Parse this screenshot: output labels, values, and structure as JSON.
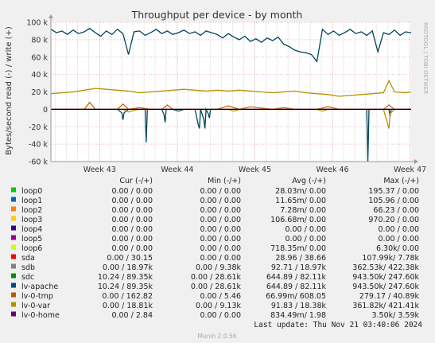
{
  "chart_data": {
    "type": "line",
    "title": "Throughput per device - by month",
    "ylabel": "Bytes/second read (-) / write (+)",
    "side_label": "RRDTOOL / TOBI OETIKER",
    "footer": "Munin 2.0.56",
    "last_update": "Last update: Thu Nov 21 03:40:06 2024",
    "ylim": [
      -60000,
      100000
    ],
    "yticks": [
      {
        "value": 100000,
        "label": "100 k"
      },
      {
        "value": 80000,
        "label": "80 k"
      },
      {
        "value": 60000,
        "label": "60 k"
      },
      {
        "value": 40000,
        "label": "40 k"
      },
      {
        "value": 20000,
        "label": "20 k"
      },
      {
        "value": 0,
        "label": "0"
      },
      {
        "value": -20000,
        "label": "-20 k"
      },
      {
        "value": -40000,
        "label": "-40 k"
      },
      {
        "value": -60000,
        "label": "-60 k"
      }
    ],
    "xlim": [
      0,
      32.5
    ],
    "xlim_note": "x in days since start of window",
    "xticks": [
      {
        "value": 4.4,
        "label": "Week 43"
      },
      {
        "value": 11.4,
        "label": "Week 44"
      },
      {
        "value": 18.4,
        "label": "Week 45"
      },
      {
        "value": 25.4,
        "label": "Week 46"
      },
      {
        "value": 32.4,
        "label": "Week 47"
      }
    ],
    "series": [
      {
        "name": "lv-apache write",
        "color": "#00455C",
        "x": [
          0,
          0.5,
          1,
          1.5,
          2,
          2.5,
          3,
          3.5,
          4,
          4.5,
          5,
          5.5,
          6,
          6.5,
          7,
          7.5,
          8,
          8.5,
          9,
          9.5,
          10,
          10.5,
          11,
          11.5,
          12,
          12.5,
          13,
          13.5,
          14,
          14.5,
          15,
          15.5,
          16,
          16.5,
          17,
          17.5,
          18,
          18.5,
          19,
          19.5,
          20,
          20.5,
          21,
          21.5,
          22,
          22.5,
          23,
          23.5,
          24,
          24.5,
          25,
          25.5,
          26,
          26.5,
          27,
          27.5,
          28,
          28.5,
          29,
          29.5,
          30,
          30.5,
          31,
          31.5,
          32,
          32.5
        ],
        "values": [
          92000,
          88000,
          90000,
          86000,
          91000,
          87000,
          89000,
          93000,
          88000,
          84000,
          90000,
          86000,
          92000,
          87000,
          63000,
          89000,
          90000,
          85000,
          88000,
          92000,
          87000,
          90000,
          86000,
          88000,
          91000,
          87000,
          89000,
          85000,
          90000,
          88000,
          86000,
          82000,
          87000,
          83000,
          80000,
          84000,
          78000,
          81000,
          77000,
          82000,
          79000,
          83000,
          75000,
          72000,
          68000,
          66000,
          65000,
          63000,
          55000,
          92000,
          86000,
          90000,
          85000,
          88000,
          92000,
          87000,
          89000,
          85000,
          90000,
          66000,
          88000,
          86000,
          91000,
          85000,
          89000,
          88000
        ]
      },
      {
        "name": "lv-apache read",
        "color": "#00455C",
        "x": [
          0,
          1,
          2,
          3,
          4,
          5,
          6,
          6.4,
          6.5,
          6.6,
          7,
          8,
          8.5,
          8.6,
          8.7,
          9,
          10,
          10.2,
          10.3,
          10.4,
          11,
          11.5,
          12,
          12.5,
          13,
          13.3,
          13.4,
          13.5,
          13.8,
          13.9,
          14,
          14.2,
          14.3,
          14.4,
          15,
          16,
          17,
          18,
          19,
          20,
          21,
          22,
          23,
          24,
          25,
          26,
          27,
          28,
          28.5,
          28.6,
          28.7,
          29,
          30,
          30.5,
          30.6,
          30.7,
          31,
          32,
          32.5
        ],
        "values": [
          0,
          0,
          0,
          0,
          0,
          0,
          0,
          -4000,
          -12000,
          -4000,
          0,
          0,
          0,
          -38000,
          0,
          0,
          0,
          -6000,
          -15000,
          0,
          0,
          -2000,
          0,
          0,
          0,
          -18000,
          -22000,
          0,
          -12000,
          -22000,
          0,
          -5000,
          -10000,
          0,
          0,
          0,
          0,
          0,
          0,
          0,
          0,
          0,
          0,
          0,
          0,
          0,
          0,
          0,
          0,
          -60000,
          0,
          0,
          0,
          0,
          -8000,
          0,
          0,
          0,
          0
        ]
      },
      {
        "name": "lv-0-var write",
        "color": "#B39400",
        "x": [
          0,
          1,
          2,
          3,
          4,
          5,
          6,
          7,
          8,
          9,
          10,
          11,
          12,
          13,
          14,
          15,
          16,
          17,
          18,
          19,
          20,
          21,
          22,
          23,
          24,
          25,
          26,
          27,
          28,
          29,
          30,
          30.5,
          31,
          32,
          32.5
        ],
        "values": [
          18000,
          19000,
          20000,
          22000,
          24000,
          23000,
          22000,
          21000,
          19000,
          20000,
          21000,
          22000,
          23000,
          22000,
          21000,
          22000,
          21000,
          22000,
          21000,
          20000,
          19000,
          20000,
          21000,
          19000,
          18000,
          17000,
          15000,
          16000,
          17000,
          18000,
          19000,
          33000,
          20000,
          19000,
          20000
        ]
      },
      {
        "name": "lv-0-var read",
        "color": "#B39400",
        "x": [
          0,
          6.5,
          7,
          7.5,
          8,
          16,
          16.5,
          17,
          24,
          24.5,
          25,
          30,
          30.5,
          30.6,
          31,
          32.5
        ],
        "values": [
          0,
          0,
          -3000,
          -1000,
          0,
          0,
          -2000,
          0,
          0,
          -2000,
          0,
          0,
          -22000,
          -5000,
          0,
          0
        ]
      },
      {
        "name": "lv-0-tmp write",
        "color": "#CC6600",
        "x": [
          0,
          3,
          3.5,
          4,
          6,
          6.5,
          7,
          8,
          9,
          10,
          10.5,
          11,
          15,
          16,
          17,
          18,
          20,
          21,
          22,
          24,
          25,
          26,
          28,
          30,
          30.5,
          31,
          32.5
        ],
        "values": [
          0,
          0,
          8000,
          0,
          0,
          6000,
          0,
          2000,
          0,
          0,
          5000,
          0,
          0,
          4000,
          0,
          3000,
          0,
          2000,
          0,
          0,
          3000,
          0,
          0,
          0,
          5000,
          0,
          0
        ]
      },
      {
        "name": "lv-0-home write",
        "color": "#660066",
        "x": [
          0,
          32.5
        ],
        "values": [
          0,
          0
        ]
      }
    ],
    "legend": {
      "headers": {
        "cur": "Cur (-/+)",
        "min": "Min (-/+)",
        "avg": "Avg (-/+)",
        "max": "Max (-/+)"
      },
      "rows": [
        {
          "name": "loop0",
          "color": "#00CC00",
          "cur": "0.00 /   0.00",
          "min": "0.00 /   0.00",
          "avg": "28.03m/   0.00",
          "max": "195.37 /   0.00"
        },
        {
          "name": "loop1",
          "color": "#0066B3",
          "cur": "0.00 /   0.00",
          "min": "0.00 /   0.00",
          "avg": "11.65m/   0.00",
          "max": "105.96 /   0.00"
        },
        {
          "name": "loop2",
          "color": "#FF8000",
          "cur": "0.00 /   0.00",
          "min": "0.00 /   0.00",
          "avg": "7.28m/   0.00",
          "max": "66.23 /   0.00"
        },
        {
          "name": "loop3",
          "color": "#FFCC00",
          "cur": "0.00 /   0.00",
          "min": "0.00 /   0.00",
          "avg": "106.68m/   0.00",
          "max": "970.20 /   0.00"
        },
        {
          "name": "loop4",
          "color": "#330099",
          "cur": "0.00 /   0.00",
          "min": "0.00 /   0.00",
          "avg": "0.00 /   0.00",
          "max": "0.00 /   0.00"
        },
        {
          "name": "loop5",
          "color": "#990099",
          "cur": "0.00 /   0.00",
          "min": "0.00 /   0.00",
          "avg": "0.00 /   0.00",
          "max": "0.00 /   0.00"
        },
        {
          "name": "loop6",
          "color": "#CCFF00",
          "cur": "0.00 /   0.00",
          "min": "0.00 /   0.00",
          "avg": "718.35m/   0.00",
          "max": "6.30k/   0.00"
        },
        {
          "name": "sda",
          "color": "#FF0000",
          "cur": "0.00 /  30.15",
          "min": "0.00 /   0.00",
          "avg": "28.96 /  38.66",
          "max": "107.99k/   7.78k"
        },
        {
          "name": "sdb",
          "color": "#808080",
          "cur": "0.00 /  18.97k",
          "min": "0.00 /   9.38k",
          "avg": "92.71 /  18.97k",
          "max": "362.53k/ 422.38k"
        },
        {
          "name": "sdc",
          "color": "#008F00",
          "cur": "10.24 /  89.35k",
          "min": "0.00 /  28.61k",
          "avg": "644.89 /  82.11k",
          "max": "943.50k/ 247.60k"
        },
        {
          "name": "lv-apache",
          "color": "#00487D",
          "cur": "10.24 /  89.35k",
          "min": "0.00 /  28.61k",
          "avg": "644.89 /  82.11k",
          "max": "943.50k/ 247.60k"
        },
        {
          "name": "lv-0-tmp",
          "color": "#B35A00",
          "cur": "0.00 / 162.82",
          "min": "0.00 /   5.46",
          "avg": "66.99m/ 608.05",
          "max": "279.17 /  40.89k"
        },
        {
          "name": "lv-0-var",
          "color": "#B38F00",
          "cur": "0.00 /  18.81k",
          "min": "0.00 /   9.13k",
          "avg": "91.83 /  18.38k",
          "max": "361.82k/ 421.41k"
        },
        {
          "name": "lv-0-home",
          "color": "#6B006B",
          "cur": "0.00 /   2.84",
          "min": "0.00 /   0.00",
          "avg": "834.49m/   1.98",
          "max": "3.50k/   3.59k"
        }
      ]
    }
  }
}
